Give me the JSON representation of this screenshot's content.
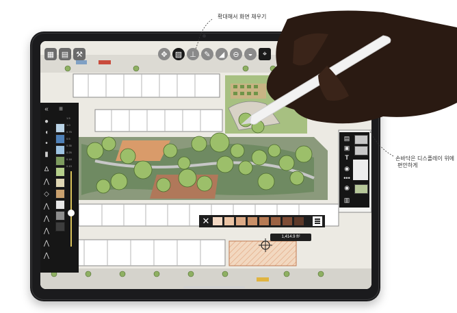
{
  "annotations": {
    "top_note": "확대해서 화면 채우기",
    "right_note_line1": "손바닥은 디스플레이 위에",
    "right_note_line2": "편안하게"
  },
  "toolbar": {
    "left_icons": [
      "grid-icon",
      "layers-icon",
      "wrench-icon"
    ],
    "tool_icons": [
      "transform-icon",
      "hatch-icon",
      "ruler-icon",
      "pencil-icon",
      "triangle-icon",
      "minus-circle-icon",
      "ellipse-icon",
      "crosshair-icon"
    ],
    "active_tool": "hatch-icon"
  },
  "palette": {
    "back_glyph": "«",
    "menu_icon": "menu-icon",
    "swatches": [
      "#b9d3e6",
      "#4f81b8",
      "#9ec4e2",
      "#7d9b5e",
      "#b5cf8a",
      "#e0d7b4",
      "#c9a06e",
      "#e8e8e8",
      "#8d8d8d",
      "#3d3d3d"
    ],
    "size_labels": [
      "1.5",
      "1.0",
      "0.75",
      "0.5",
      "0.35",
      "0.25",
      "0.18",
      "0.13"
    ],
    "opacity_level": 0.45
  },
  "right_panel": {
    "icons": [
      "layers-icon",
      "image-icon",
      "text-icon",
      "eye-icon",
      "more-icon",
      "eye-icon",
      "trash-icon"
    ],
    "text_glyph": "T"
  },
  "colorbar": {
    "close_glyph": "✕",
    "swatches": [
      "#f3d9c4",
      "#ebc4a5",
      "#dcaa86",
      "#c99068",
      "#b77b54",
      "#9c6243",
      "#7e4c35",
      "#5d3929"
    ]
  },
  "measurement": {
    "value": "1,414.9",
    "unit": "ft²"
  }
}
